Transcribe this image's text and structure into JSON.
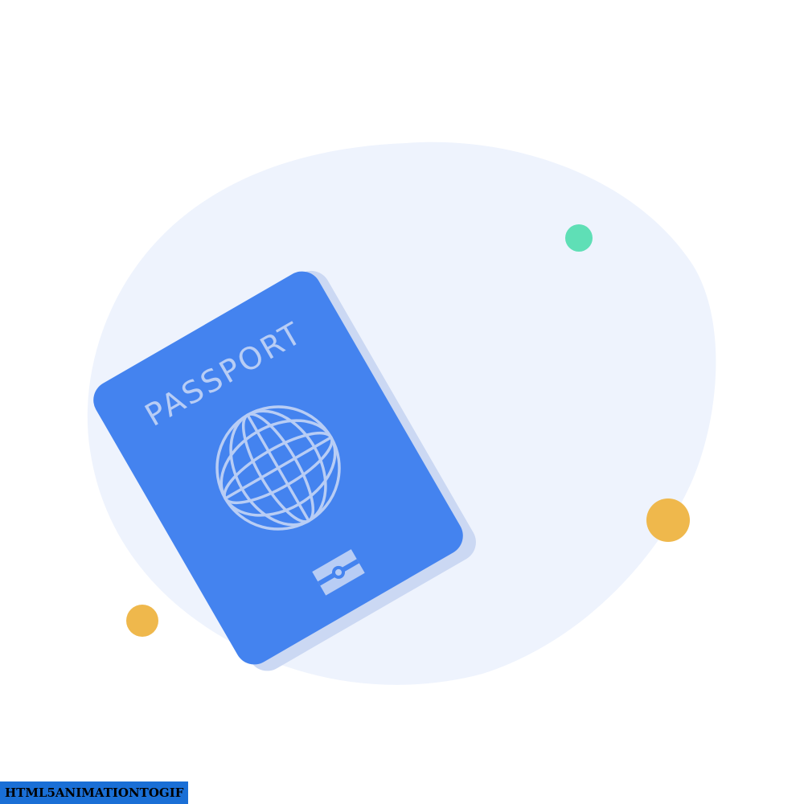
{
  "passport": {
    "title": "PASSPORT"
  },
  "watermark": {
    "text": "HTML5ANIMATIONTOGIF"
  },
  "colors": {
    "background": "#ffffff",
    "blob": "#eef3fd",
    "passport_cover": "#4483ef",
    "passport_shadow": "#cbd8f3",
    "passport_emboss": "#b8cdf5",
    "dot_green": "#5fdfb6",
    "dot_yellow": "#efb84c",
    "watermark_bg": "#1a6fd6"
  },
  "icons": [
    "globe-icon",
    "biometric-chip-icon"
  ]
}
